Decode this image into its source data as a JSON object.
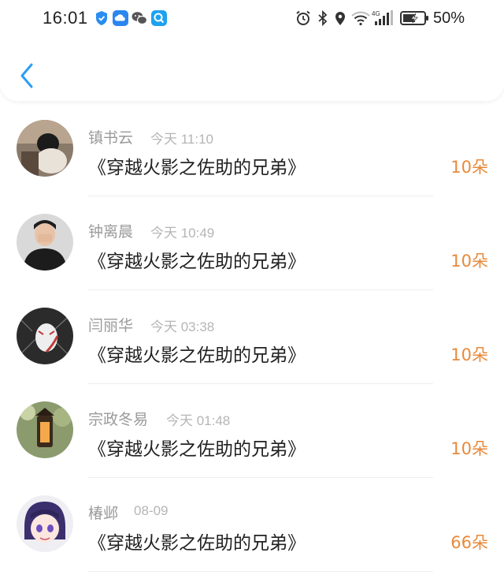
{
  "status_bar": {
    "time": "16:01",
    "battery": "50%",
    "icons": [
      "shield-app-icon",
      "cloud-app-icon",
      "wechat-icon",
      "search-app-icon",
      "alarm-icon",
      "bluetooth-icon",
      "location-icon",
      "wifi-icon",
      "signal-4g-icon",
      "battery-icon"
    ]
  },
  "header": {
    "back_icon": "chevron-left-icon"
  },
  "colors": {
    "accent": "#2a9df4",
    "count": "#e8893a",
    "name": "#9a9a9a",
    "title": "#222222"
  },
  "items": [
    {
      "name": "镇书云",
      "time": "今天 11:10",
      "title": "《穿越火影之佐助的兄弟》",
      "count": "10朵"
    },
    {
      "name": "钟离晨",
      "time": "今天 10:49",
      "title": "《穿越火影之佐助的兄弟》",
      "count": "10朵"
    },
    {
      "name": "闫丽华",
      "time": "今天 03:38",
      "title": "《穿越火影之佐助的兄弟》",
      "count": "10朵"
    },
    {
      "name": "宗政冬易",
      "time": "今天 01:48",
      "title": "《穿越火影之佐助的兄弟》",
      "count": "10朵"
    },
    {
      "name": "椿邺",
      "time": "08-09",
      "title": "《穿越火影之佐助的兄弟》",
      "count": "66朵"
    }
  ]
}
